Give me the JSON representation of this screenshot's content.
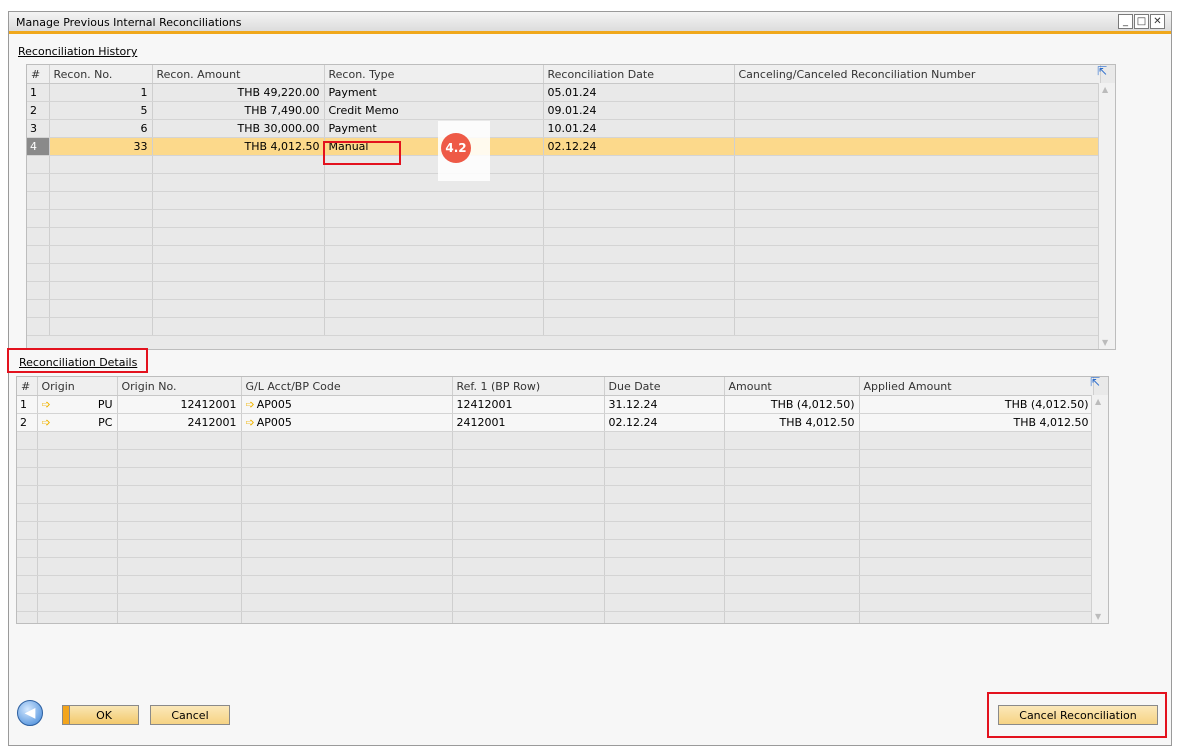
{
  "window": {
    "title": "Manage Previous Internal Reconciliations",
    "min_glyph": "_",
    "max_glyph": "□",
    "close_glyph": "✕"
  },
  "history": {
    "label": "Reconciliation History",
    "columns": [
      "#",
      "Recon. No.",
      "Recon. Amount",
      "Recon. Type",
      "Reconciliation Date",
      "Canceling/Canceled Reconciliation Number"
    ],
    "rows": [
      {
        "idx": "1",
        "no": "1",
        "amount": "THB 49,220.00",
        "type": "Payment",
        "date": "05.01.24",
        "cancel": ""
      },
      {
        "idx": "2",
        "no": "5",
        "amount": "THB 7,490.00",
        "type": "Credit Memo",
        "date": "09.01.24",
        "cancel": ""
      },
      {
        "idx": "3",
        "no": "6",
        "amount": "THB 30,000.00",
        "type": "Payment",
        "date": "10.01.24",
        "cancel": ""
      },
      {
        "idx": "4",
        "no": "33",
        "amount": "THB 4,012.50",
        "type": "Manual",
        "date": "02.12.24",
        "cancel": ""
      }
    ]
  },
  "details": {
    "label": "Reconciliation Details",
    "columns": [
      "#",
      "Origin",
      "Origin No.",
      "G/L Acct/BP Code",
      "Ref. 1 (BP Row)",
      "Due Date",
      "Amount",
      "Applied Amount"
    ],
    "rows": [
      {
        "idx": "1",
        "origin": "PU",
        "origin_no": "12412001",
        "bp": "AP005",
        "ref": "12412001",
        "due": "31.12.24",
        "amount": "THB (4,012.50)",
        "applied": "THB (4,012.50)"
      },
      {
        "idx": "2",
        "origin": "PC",
        "origin_no": "2412001",
        "bp": "AP005",
        "ref": "2412001",
        "due": "02.12.24",
        "amount": "THB  4,012.50",
        "applied": "THB  4,012.50"
      }
    ]
  },
  "buttons": {
    "ok": "OK",
    "cancel": "Cancel",
    "cancel_reconciliation": "Cancel Reconciliation"
  },
  "annotation": {
    "step_badge": "4.2"
  },
  "icons": {
    "back": "back-arrow-icon",
    "link_arrow": "link-arrow-icon",
    "expand": "expand-icon"
  },
  "colors": {
    "title_accent": "#f0a81c",
    "selected_row": "#fcd98b",
    "highlight": "#e3121e",
    "badge": "#ee5a47"
  }
}
